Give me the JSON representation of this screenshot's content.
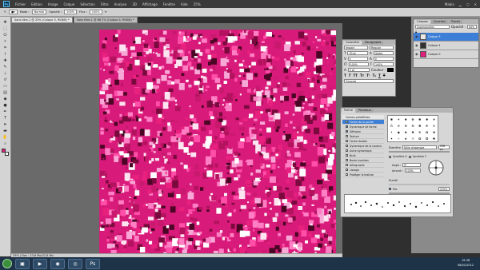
{
  "app": {
    "logo": "Ps",
    "user": "Mabia"
  },
  "menu": [
    "Fichier",
    "Edition",
    "Image",
    "Calque",
    "Sélection",
    "Filtre",
    "Analyse",
    "3D",
    "Affichage",
    "Fenêtre",
    "Aide"
  ],
  "zoom_display": "25%",
  "options": {
    "mode_label": "Mode :",
    "mode_value": "Normal",
    "opacity_label": "Opacité :",
    "opacity_value": "100%",
    "flux_label": "Flux :",
    "flux_value": "100%"
  },
  "tabs": [
    {
      "label": "Sans titre-1 @ 25% (Calque 3, RVB/8) *"
    },
    {
      "label": "Sans titre-1 @ 66,7% (Calque 4, RVB/8) *"
    }
  ],
  "status_text": "25% | Doc : 23,6 Mo/22,8 Mo",
  "layers": {
    "tabs": [
      "Calques",
      "Couches",
      "Tracés"
    ],
    "blend": "Superposition",
    "opacity_label": "Opacité :",
    "opacity_value": "84%",
    "rows": [
      {
        "name": "Calque 3",
        "selected": true,
        "thumb": "#e8e8e8"
      },
      {
        "name": "Calque 4",
        "selected": false,
        "thumb": "#333333"
      },
      {
        "name": "Calque 0",
        "selected": false,
        "thumb": "#e0207c"
      }
    ]
  },
  "character": {
    "tabs": [
      "Caractère",
      "Paragraphe"
    ],
    "font": "Impact",
    "style": "Regular",
    "size": "30 pt",
    "leading": "(Auto)",
    "tracking": "0",
    "scale_v": "100%",
    "scale_h": "100%",
    "baseline": "0 pt",
    "color_label": "Couleur :",
    "lang": "Français"
  },
  "brush": {
    "tabs": [
      "Forme",
      "Pinceaux"
    ],
    "preset_label": "Formes prédéfinies",
    "options": [
      {
        "label": "Forme de la pointe",
        "selected": true,
        "check": false
      },
      {
        "label": "Dynamique de forme",
        "selected": false,
        "check": true
      },
      {
        "label": "Diffusion",
        "selected": false,
        "check": true
      },
      {
        "label": "Texture",
        "selected": false,
        "check": false
      },
      {
        "label": "Forme double",
        "selected": false,
        "check": false
      },
      {
        "label": "Dynamique de la couleur",
        "selected": false,
        "check": false
      },
      {
        "label": "Autre dynamique",
        "selected": false,
        "check": false
      },
      {
        "label": "Bruit",
        "selected": false,
        "check": false
      },
      {
        "label": "Bords humides",
        "selected": false,
        "check": false
      },
      {
        "label": "Aérographe",
        "selected": false,
        "check": false
      },
      {
        "label": "Lissage",
        "selected": false,
        "check": false
      },
      {
        "label": "Protéger la texture",
        "selected": false,
        "check": false
      }
    ],
    "diameter_label": "Diamètre",
    "sample_btn": "Taille d'exemple",
    "diameter_value": "228 px",
    "flip_x": "Symétrie X",
    "flip_y": "Symétrie Y",
    "angle_label": "Angle :",
    "angle_value": "0°",
    "roundness_label": "Arrondi :",
    "roundness_value": "100%",
    "hardness_label": "Dureté",
    "spacing_label": "Pas",
    "spacing_value": "215%"
  },
  "taskbar": {
    "time": "19:38",
    "date": "06/01/2012"
  },
  "colors": {
    "canvas_base": "#d81a7a",
    "fg": "#e8207e",
    "bg": "#ffffff"
  }
}
